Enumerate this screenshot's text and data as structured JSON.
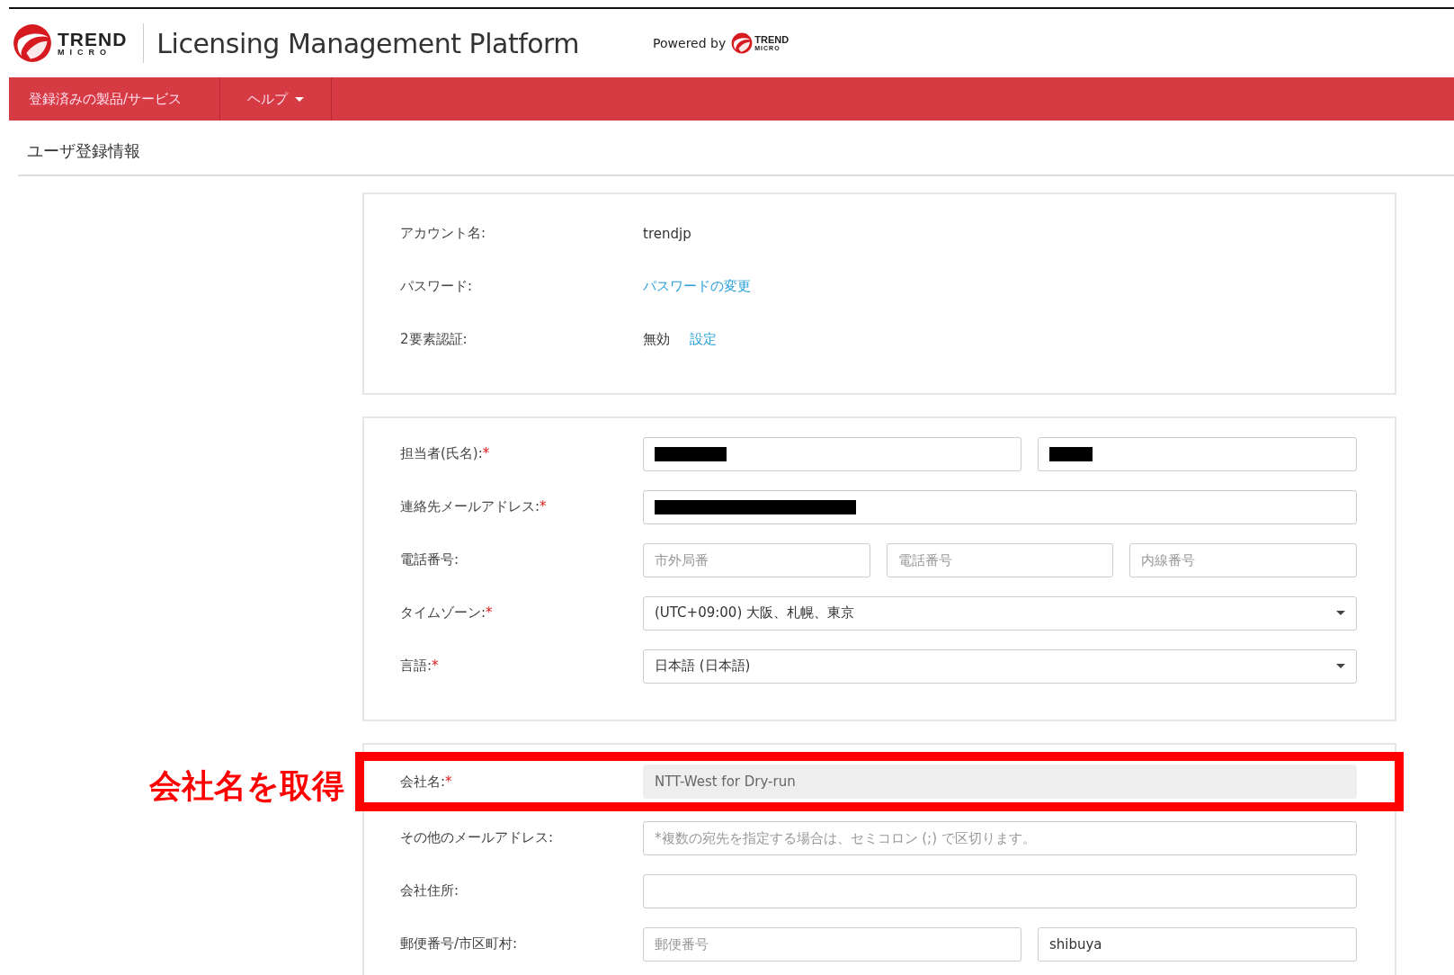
{
  "header": {
    "logo_word": "TREND",
    "logo_subword": "MICRO",
    "title": "Licensing Management Platform",
    "powered_by": "Powered by",
    "powered_logo_word": "TREND",
    "powered_logo_subword": "MICRO"
  },
  "nav": [
    {
      "label": "登録済みの製品/サービス",
      "dropdown": false
    },
    {
      "label": "ヘルプ",
      "dropdown": true
    }
  ],
  "page_title": "ユーザ登録情報",
  "account": [
    {
      "label": "アカウント名:",
      "kind": "text",
      "value": "trendjp"
    },
    {
      "label": "パスワード:",
      "kind": "link",
      "link": "パスワードの変更"
    },
    {
      "label": "2要素認証:",
      "kind": "status",
      "value": "無効",
      "link": "設定"
    }
  ],
  "contact": [
    {
      "label": "担当者(氏名):",
      "required_mark": "*",
      "inputs": [
        {
          "kind": "redacted"
        },
        {
          "kind": "redacted"
        }
      ]
    },
    {
      "label": "連絡先メールアドレス:",
      "required_mark": "*",
      "inputs": [
        {
          "kind": "redacted"
        }
      ]
    },
    {
      "label": "電話番号:",
      "inputs": [
        {
          "kind": "text",
          "placeholder": "市外局番"
        },
        {
          "kind": "text",
          "placeholder": "電話番号"
        },
        {
          "kind": "text",
          "placeholder": "内線番号"
        }
      ]
    },
    {
      "label": "タイムゾーン:",
      "required_mark": "*",
      "inputs": [
        {
          "kind": "select",
          "value": "(UTC+09:00) 大阪、札幌、東京"
        }
      ]
    },
    {
      "label": "言語:",
      "required_mark": "*",
      "inputs": [
        {
          "kind": "select",
          "value": "日本語 (日本語)"
        }
      ]
    }
  ],
  "company": [
    {
      "label": "会社名:",
      "required_mark": "*",
      "highlighted": true,
      "annotation": "会社名を取得",
      "inputs": [
        {
          "kind": "text",
          "value": "NTT-West for Dry-run",
          "disabled": true
        }
      ]
    },
    {
      "label": "その他のメールアドレス:",
      "highlighted": false,
      "inputs": [
        {
          "kind": "text",
          "placeholder": "*複数の宛先を指定する場合は、セミコロン (;) で区切ります。"
        }
      ]
    },
    {
      "label": "会社住所:",
      "highlighted": false,
      "inputs": [
        {
          "kind": "text"
        }
      ]
    },
    {
      "label": "郵便番号/市区町村:",
      "highlighted": false,
      "inputs": [
        {
          "kind": "text",
          "placeholder": "郵便番号"
        },
        {
          "kind": "text",
          "value": "shibuya"
        }
      ]
    }
  ]
}
